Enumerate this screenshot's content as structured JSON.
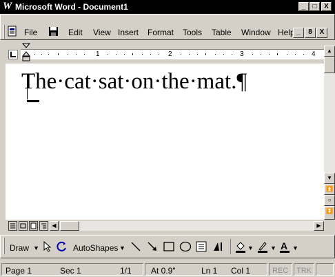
{
  "window": {
    "title": "Microsoft Word - Document1",
    "logo_letter": "W",
    "minimize_glyph": "_",
    "maximize_glyph": "□",
    "close_glyph": "X"
  },
  "menu": {
    "file": "File",
    "edit": "Edit",
    "view": "View",
    "insert": "Insert",
    "format": "Format",
    "tools": "Tools",
    "table": "Table",
    "window": "Window",
    "help": "Help",
    "doc_min": "_",
    "doc_restore": "8",
    "doc_close": "X"
  },
  "ruler": {
    "marks": [
      "1",
      "2",
      "3",
      "4"
    ]
  },
  "document": {
    "text": "The·cat·sat·on·the·mat.¶"
  },
  "drawing_toolbar": {
    "draw": "Draw",
    "autoshapes": "AutoShapes"
  },
  "status": {
    "page": "Page 1",
    "sec": "Sec 1",
    "pages": "1/1",
    "at": "At 0.9\"",
    "ln": "Ln 1",
    "col": "Col 1",
    "rec": "REC",
    "trk": "TRK"
  }
}
